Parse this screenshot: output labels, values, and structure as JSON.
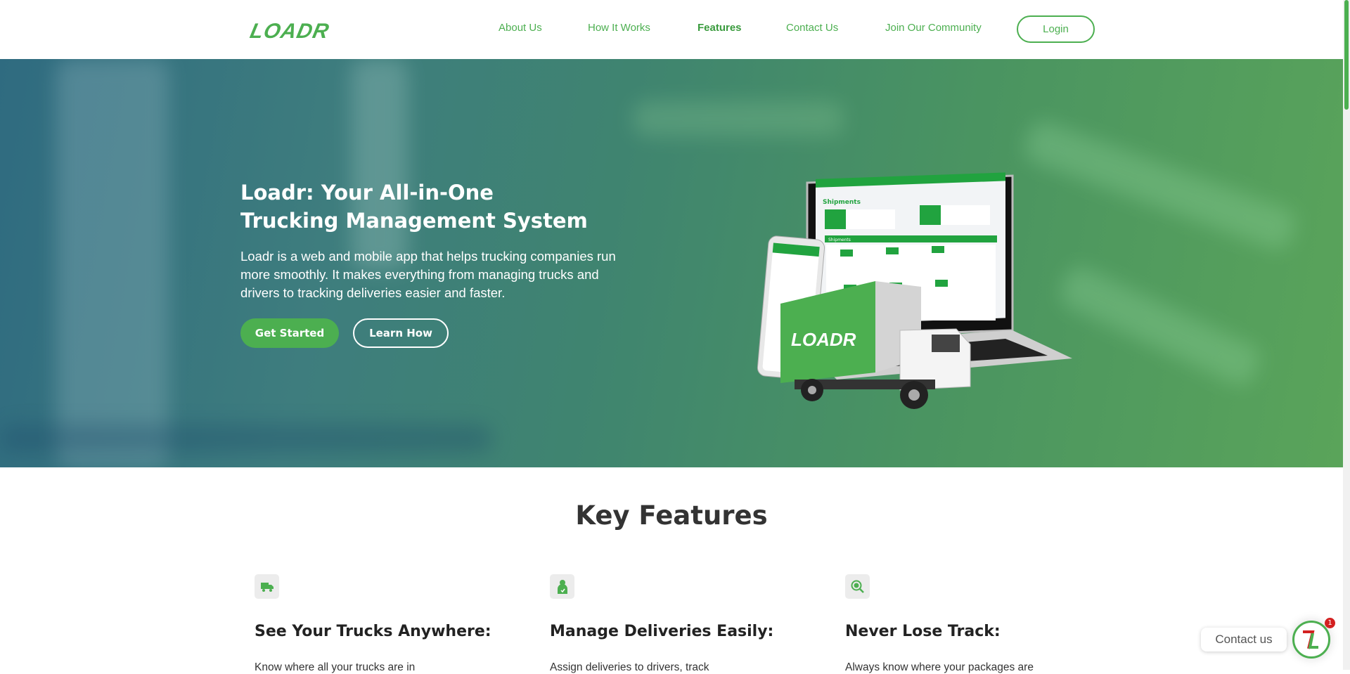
{
  "brand": {
    "logo": "LOADR",
    "accent": "#4caf50"
  },
  "nav": {
    "items": [
      "About Us",
      "How It Works",
      "Features",
      "Contact Us",
      "Join Our Community"
    ],
    "active": "Features",
    "login": "Login"
  },
  "hero": {
    "title_line1": "Loadr: Your All-in-One",
    "title_line2": "Trucking Management System",
    "description": "Loadr is a web and mobile app that helps trucking companies run more smoothly. It makes everything from managing trucks and drivers to tracking deliveries easier and faster.",
    "get_started": "Get Started",
    "learn_how": "Learn How",
    "illustration": {
      "screen_title": "Shipments",
      "panel_title": "Shipments",
      "truck_logo": "LOADR"
    }
  },
  "features": {
    "heading": "Key Features",
    "items": [
      {
        "icon": "truck-icon",
        "title": "See Your Trucks Anywhere:",
        "text": "Know where all your trucks are in"
      },
      {
        "icon": "driver-icon",
        "title": "Manage Deliveries Easily:",
        "text": "Assign deliveries to drivers, track"
      },
      {
        "icon": "search-check-icon",
        "title": "Never Lose Track:",
        "text": "Always know where your packages are"
      }
    ]
  },
  "chat": {
    "label": "Contact us",
    "badge": "1"
  }
}
